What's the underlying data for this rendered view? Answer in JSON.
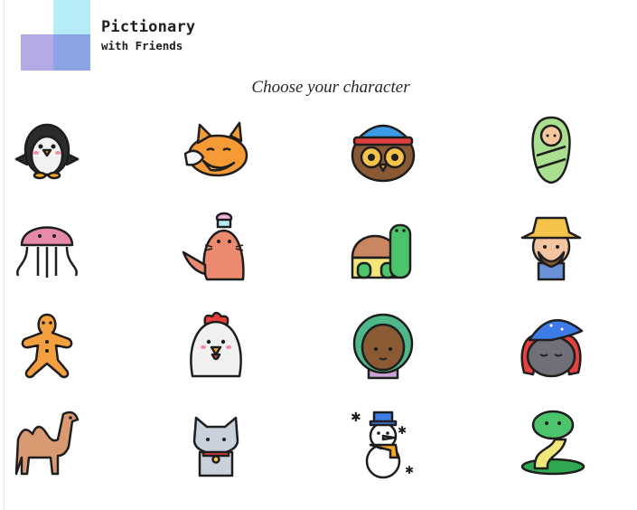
{
  "app": {
    "title": "Pictionary",
    "subtitle": "with Friends"
  },
  "heading": "Choose your character",
  "characters": [
    {
      "icon": "penguin-icon"
    },
    {
      "icon": "fox-icon"
    },
    {
      "icon": "owl-icon"
    },
    {
      "icon": "swaddled-baby-icon"
    },
    {
      "icon": "jellyfish-icon"
    },
    {
      "icon": "seal-icon"
    },
    {
      "icon": "turtle-icon"
    },
    {
      "icon": "farmer-icon"
    },
    {
      "icon": "gingerbread-man-icon"
    },
    {
      "icon": "rooster-icon"
    },
    {
      "icon": "girl-icon"
    },
    {
      "icon": "wizard-rabbit-icon"
    },
    {
      "icon": "camel-icon"
    },
    {
      "icon": "cat-icon"
    },
    {
      "icon": "snowman-icon"
    },
    {
      "icon": "snake-icon"
    }
  ],
  "colors": {
    "logo_cyan": "#b6ecf8",
    "logo_purple": "#b4a9e4",
    "logo_blue": "#8aa4e6",
    "outline": "#1e1e1e"
  }
}
